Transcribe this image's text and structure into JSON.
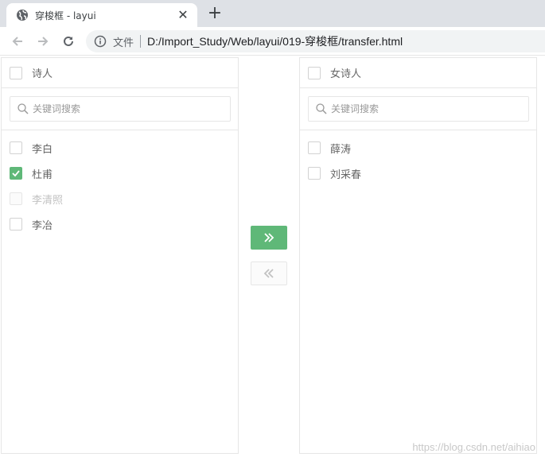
{
  "browser": {
    "tab_title": "穿梭框 - layui",
    "tab_close": "✕",
    "new_tab": "+",
    "scheme_label": "文件",
    "url": "D:/Import_Study/Web/layui/019-穿梭框/transfer.html"
  },
  "transfer": {
    "left": {
      "title": "诗人",
      "search_placeholder": "关键词搜索",
      "items": [
        {
          "label": "李白",
          "checked": false,
          "disabled": false
        },
        {
          "label": "杜甫",
          "checked": true,
          "disabled": false
        },
        {
          "label": "李清照",
          "checked": false,
          "disabled": true
        },
        {
          "label": "李冶",
          "checked": false,
          "disabled": false
        }
      ]
    },
    "right": {
      "title": "女诗人",
      "search_placeholder": "关键词搜索",
      "items": [
        {
          "label": "薛涛",
          "checked": false,
          "disabled": false
        },
        {
          "label": "刘采春",
          "checked": false,
          "disabled": false
        }
      ]
    },
    "move_right_enabled": true,
    "move_left_enabled": false
  },
  "colors": {
    "accent": "#5fb878",
    "border": "#e6e6e6"
  },
  "watermark": "https://blog.csdn.net/aihiao"
}
